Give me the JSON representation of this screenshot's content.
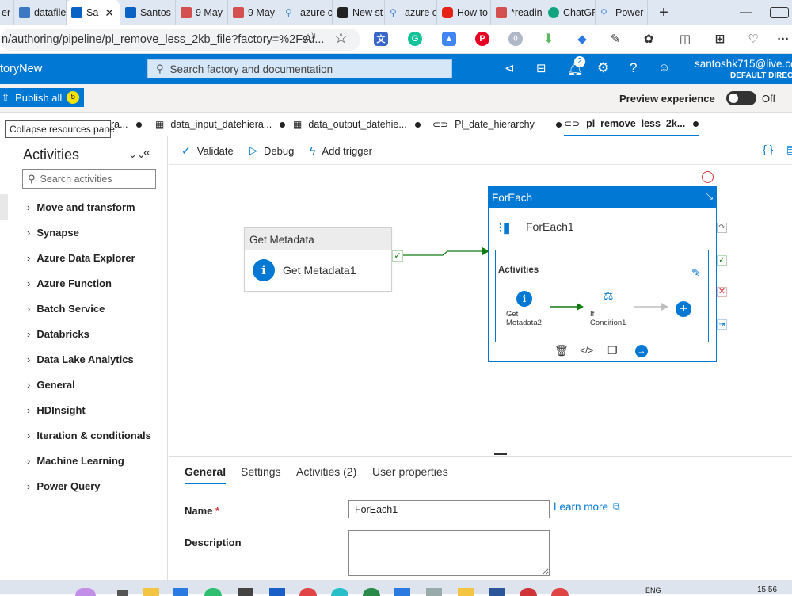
{
  "browser": {
    "tabs": [
      {
        "label": "er",
        "color": "#888"
      },
      {
        "label": "datafile",
        "color": "#3a78c4"
      },
      {
        "label": "Sa",
        "color": "#0a62c4"
      },
      {
        "label": "Santos",
        "color": "#0a62c4"
      },
      {
        "label": "9 May",
        "color": "#d45050"
      },
      {
        "label": "9 May",
        "color": "#d45050"
      },
      {
        "label": "azure c",
        "color": "#4a88d8"
      },
      {
        "label": "New st",
        "color": "#222"
      },
      {
        "label": "azure c",
        "color": "#4a88d8"
      },
      {
        "label": "How to",
        "color": "#e62117"
      },
      {
        "label": "*readin",
        "color": "#d45050"
      },
      {
        "label": "ChatGF",
        "color": "#10a37f"
      },
      {
        "label": "Power",
        "color": "#4a88d8"
      }
    ],
    "new_tab": "+",
    "url": "n/authoring/pipeline/pl_remove_less_2kb_file?factory=%2Fsu...",
    "read_aloud": "A̅̆"
  },
  "app": {
    "name": "toryNew",
    "search_placeholder": "Search factory and documentation",
    "notification_count": "2",
    "user_email": "santoshk715@live.co",
    "user_directory": "DEFAULT DIRECTO"
  },
  "toolbar": {
    "publish_label": "Publish all",
    "publish_count": "5",
    "preview_label": "Preview experience",
    "toggle_state": "Off"
  },
  "tooltip": "Collapse resources pane",
  "pipeline_tabs": [
    {
      "label": "ra..."
    },
    {
      "label": "data_input_datehiera..."
    },
    {
      "label": "data_output_datehie..."
    },
    {
      "label": "Pl_date_hierarchy"
    },
    {
      "label": "pl_remove_less_2k..."
    }
  ],
  "activities": {
    "title": "Activities",
    "search_placeholder": "Search activities",
    "items": [
      "Move and transform",
      "Synapse",
      "Azure Data Explorer",
      "Azure Function",
      "Batch Service",
      "Databricks",
      "Data Lake Analytics",
      "General",
      "HDInsight",
      "Iteration & conditionals",
      "Machine Learning",
      "Power Query"
    ]
  },
  "canvas_toolbar": {
    "validate": "Validate",
    "debug": "Debug",
    "add_trigger": "Add trigger"
  },
  "get_metadata": {
    "header": "Get Metadata",
    "name": "Get Metadata1"
  },
  "foreach": {
    "header": "ForEach",
    "name": "ForEach1",
    "inner_title": "Activities",
    "inner_get_line1": "Get",
    "inner_get_line2": "Metadata2",
    "inner_if_line1": "If",
    "inner_if_line2": "Condition1"
  },
  "properties": {
    "tabs": [
      "General",
      "Settings",
      "Activities (2)",
      "User properties"
    ],
    "name_label": "Name",
    "required_mark": "*",
    "name_value": "ForEach1",
    "learn_more": "Learn more",
    "description_label": "Description"
  },
  "taskbar": {
    "lang": "ENG",
    "time": "15:56"
  },
  "colors": {
    "accent": "#0078d4",
    "success": "#107c10",
    "error": "#d13438"
  }
}
